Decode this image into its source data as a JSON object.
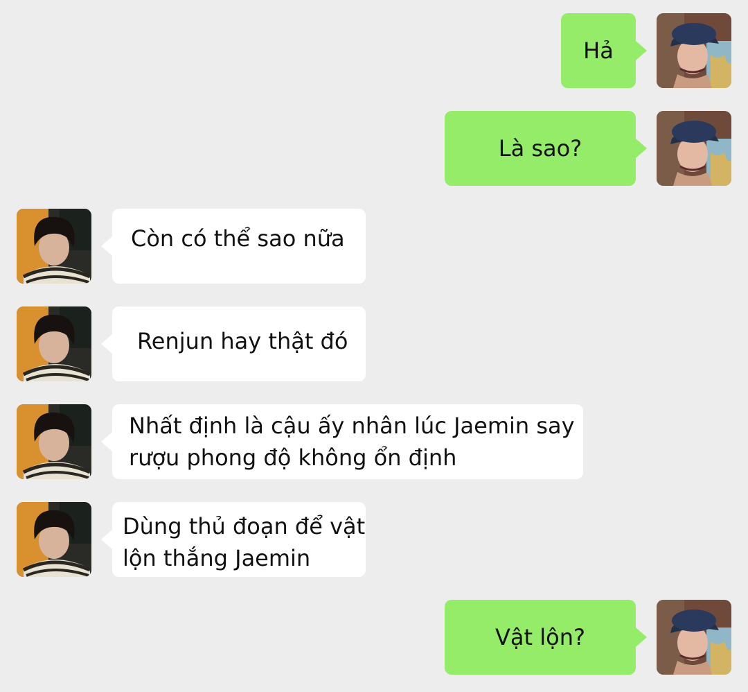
{
  "conversation": {
    "messages": [
      {
        "sender": "self",
        "avatar": "hat-avatar",
        "text": "Hả"
      },
      {
        "sender": "self",
        "avatar": "hat-avatar",
        "text": "Là sao?"
      },
      {
        "sender": "other",
        "avatar": "dark-hair-avatar",
        "text": "Còn có thể sao nữa"
      },
      {
        "sender": "other",
        "avatar": "dark-hair-avatar",
        "text": "Renjun hay thật đó"
      },
      {
        "sender": "other",
        "avatar": "dark-hair-avatar",
        "text": "Nhất định là cậu ấy nhân lúc Jaemin say\nrượu phong độ không ổn định"
      },
      {
        "sender": "other",
        "avatar": "dark-hair-avatar",
        "text": "Dùng thủ đoạn để vật\nlộn thắng Jaemin"
      },
      {
        "sender": "self",
        "avatar": "hat-avatar",
        "text": "Vật lộn?"
      }
    ]
  },
  "colors": {
    "background": "#ededed",
    "outgoing_bubble": "#95ec69",
    "incoming_bubble": "#ffffff"
  }
}
